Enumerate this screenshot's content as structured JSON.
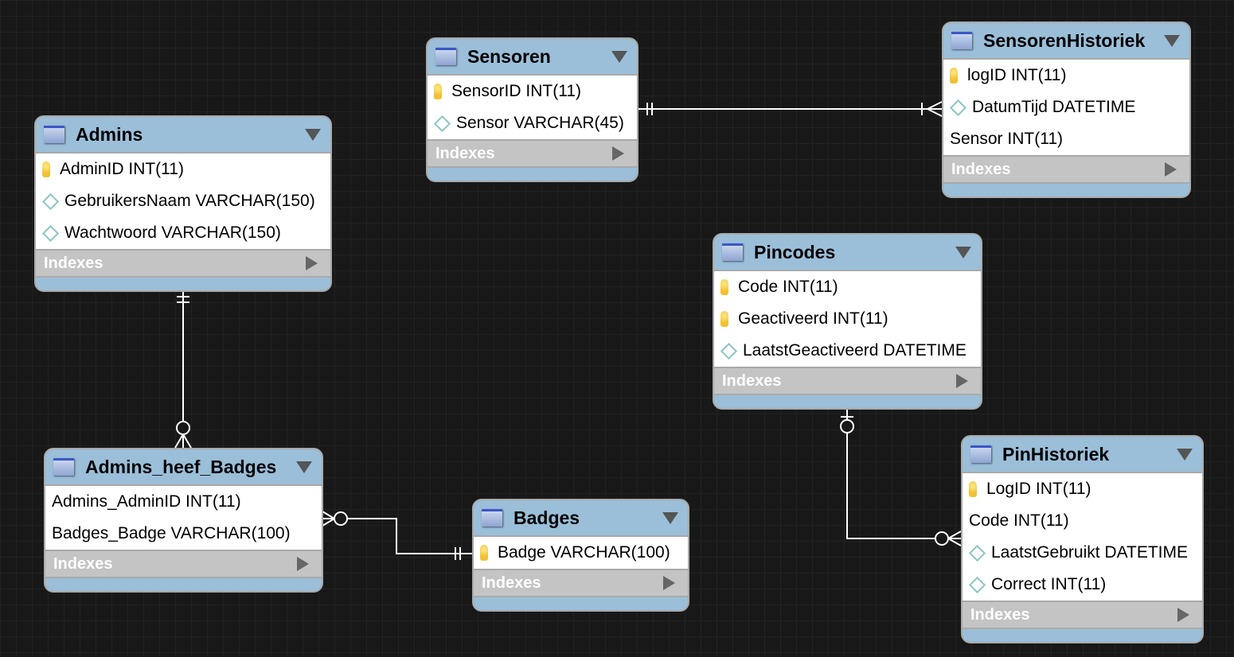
{
  "tables": [
    {
      "id": "Admins",
      "name": "Admins",
      "indexes_label": "Indexes",
      "columns": [
        {
          "name": "AdminID INT(11)",
          "icon": "key"
        },
        {
          "name": "GebruikersNaam VARCHAR(150)",
          "icon": "diamond"
        },
        {
          "name": "Wachtwoord VARCHAR(150)",
          "icon": "diamond"
        }
      ]
    },
    {
      "id": "Sensoren",
      "name": "Sensoren",
      "indexes_label": "Indexes",
      "columns": [
        {
          "name": "SensorID INT(11)",
          "icon": "key"
        },
        {
          "name": "Sensor VARCHAR(45)",
          "icon": "diamond"
        }
      ]
    },
    {
      "id": "SensorenHistoriek",
      "name": "SensorenHistoriek",
      "indexes_label": "Indexes",
      "columns": [
        {
          "name": "logID INT(11)",
          "icon": "key"
        },
        {
          "name": "DatumTijd DATETIME",
          "icon": "diamond"
        },
        {
          "name": "Sensor INT(11)",
          "icon": "none"
        }
      ]
    },
    {
      "id": "Pincodes",
      "name": "Pincodes",
      "indexes_label": "Indexes",
      "columns": [
        {
          "name": "Code INT(11)",
          "icon": "key"
        },
        {
          "name": "Geactiveerd INT(11)",
          "icon": "key"
        },
        {
          "name": "LaatstGeactiveerd DATETIME",
          "icon": "diamond"
        }
      ]
    },
    {
      "id": "Admins_heef_Badges",
      "name": "Admins_heef_Badges",
      "indexes_label": "Indexes",
      "columns": [
        {
          "name": "Admins_AdminID INT(11)",
          "icon": "none"
        },
        {
          "name": "Badges_Badge VARCHAR(100)",
          "icon": "none"
        }
      ]
    },
    {
      "id": "Badges",
      "name": "Badges",
      "indexes_label": "Indexes",
      "columns": [
        {
          "name": "Badge VARCHAR(100)",
          "icon": "key"
        }
      ]
    },
    {
      "id": "PinHistoriek",
      "name": "PinHistoriek",
      "indexes_label": "Indexes",
      "columns": [
        {
          "name": "LogID INT(11)",
          "icon": "key"
        },
        {
          "name": "Code INT(11)",
          "icon": "none"
        },
        {
          "name": "LaatstGebruikt DATETIME",
          "icon": "diamond"
        },
        {
          "name": "Correct INT(11)",
          "icon": "diamond"
        }
      ]
    }
  ],
  "relationships": [
    {
      "from": "Sensoren",
      "to": "SensorenHistoriek",
      "from_card": "one-and-only-one",
      "to_card": "one-or-many"
    },
    {
      "from": "Admins",
      "to": "Admins_heef_Badges",
      "from_card": "one-and-only-one",
      "to_card": "zero-or-many"
    },
    {
      "from": "Badges",
      "to": "Admins_heef_Badges",
      "from_card": "one-and-only-one",
      "to_card": "zero-or-many"
    },
    {
      "from": "Pincodes",
      "to": "PinHistoriek",
      "from_card": "zero-or-one",
      "to_card": "zero-or-many"
    }
  ],
  "colors": {
    "header": "#9bbfd9",
    "background": "#181818",
    "indexes": "#c4c4c4",
    "connector": "#ffffff"
  }
}
